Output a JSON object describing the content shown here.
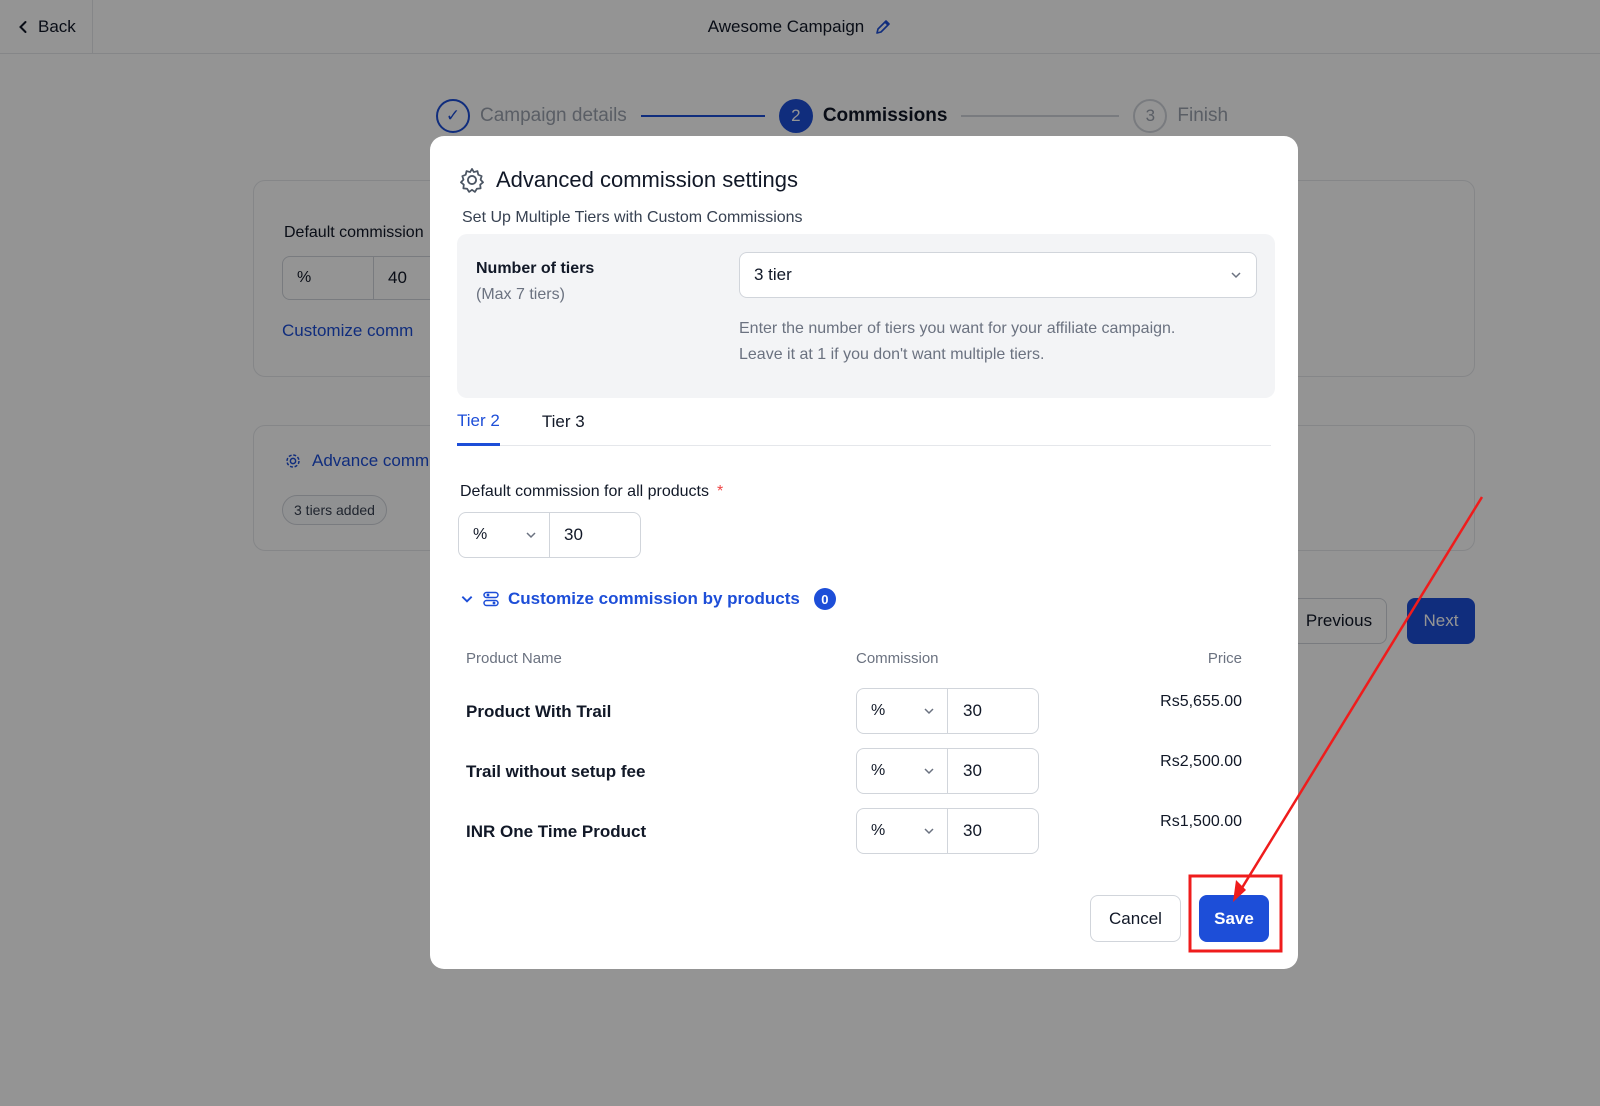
{
  "topbar": {
    "back_label": "Back",
    "campaign_title": "Awesome Campaign"
  },
  "stepper": {
    "steps": [
      {
        "number": "✓",
        "label": "Campaign details",
        "state": "done"
      },
      {
        "number": "2",
        "label": "Commissions",
        "state": "active"
      },
      {
        "number": "3",
        "label": "Finish",
        "state": "todo"
      }
    ]
  },
  "background": {
    "default_commission_label": "Default commission",
    "commission_type": "%",
    "commission_value": "40",
    "customize_link": "Customize comm",
    "advance_link": "Advance comm",
    "tiers_badge": "3 tiers added",
    "previous_label": "Previous",
    "next_label": "Next"
  },
  "modal": {
    "title": "Advanced commission settings",
    "subtitle": "Set Up Multiple Tiers with Custom Commissions",
    "tiers": {
      "label": "Number of tiers",
      "hint": "(Max 7 tiers)",
      "selected": "3 tier",
      "help_line1": "Enter the number of tiers you want for your affiliate campaign.",
      "help_line2": "Leave it at 1 if you don't want multiple tiers."
    },
    "tabs": [
      {
        "label": "Tier 2",
        "active": true
      },
      {
        "label": "Tier 3",
        "active": false
      }
    ],
    "default_commission": {
      "label": "Default commission for all products",
      "required_mark": "*",
      "type": "%",
      "value": "30"
    },
    "customize": {
      "label": "Customize commission by products",
      "count": "0"
    },
    "table": {
      "headers": {
        "name": "Product Name",
        "commission": "Commission",
        "price": "Price"
      },
      "rows": [
        {
          "name": "Product With Trail",
          "type": "%",
          "value": "30",
          "price": "Rs5,655.00"
        },
        {
          "name": "Trail without setup fee",
          "type": "%",
          "value": "30",
          "price": "Rs2,500.00"
        },
        {
          "name": "INR One Time Product",
          "type": "%",
          "value": "30",
          "price": "Rs1,500.00"
        }
      ]
    },
    "cancel_label": "Cancel",
    "save_label": "Save"
  },
  "colors": {
    "accent": "#1d4ed8",
    "annotation": "#ef1c1c",
    "overlay": "rgba(0,0,0,0.42)"
  }
}
